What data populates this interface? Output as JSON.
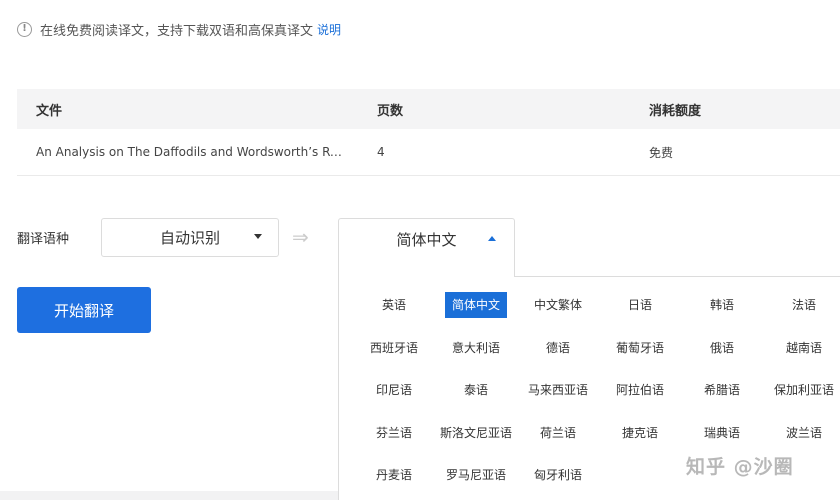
{
  "notice": {
    "icon": "info-icon",
    "text": "在线免费阅读译文，支持下载双语和高保真译文",
    "link": "说明"
  },
  "table": {
    "headers": [
      "文件",
      "页数",
      "消耗额度"
    ],
    "rows": [
      {
        "file": "An Analysis on The Daffodils and Wordsworth’s Ro...",
        "pages": "4",
        "quota": "免费"
      }
    ]
  },
  "translate": {
    "label": "翻译语种",
    "source": "自动识别",
    "target": "简体中文"
  },
  "languages": [
    "英语",
    "简体中文",
    "中文繁体",
    "日语",
    "韩语",
    "法语",
    "西班牙语",
    "意大利语",
    "德语",
    "葡萄牙语",
    "俄语",
    "越南语",
    "印尼语",
    "泰语",
    "马来西亚语",
    "阿拉伯语",
    "希腊语",
    "保加利亚语",
    "芬兰语",
    "斯洛文尼亚语",
    "荷兰语",
    "捷克语",
    "瑞典语",
    "波兰语",
    "丹麦语",
    "罗马尼亚语",
    "匈牙利语"
  ],
  "selected_language": "简体中文",
  "start_button": "开始翻译",
  "watermark": "知乎 @沙圈",
  "colors": {
    "accent": "#1e6fe0",
    "link": "#1a6fd8"
  }
}
